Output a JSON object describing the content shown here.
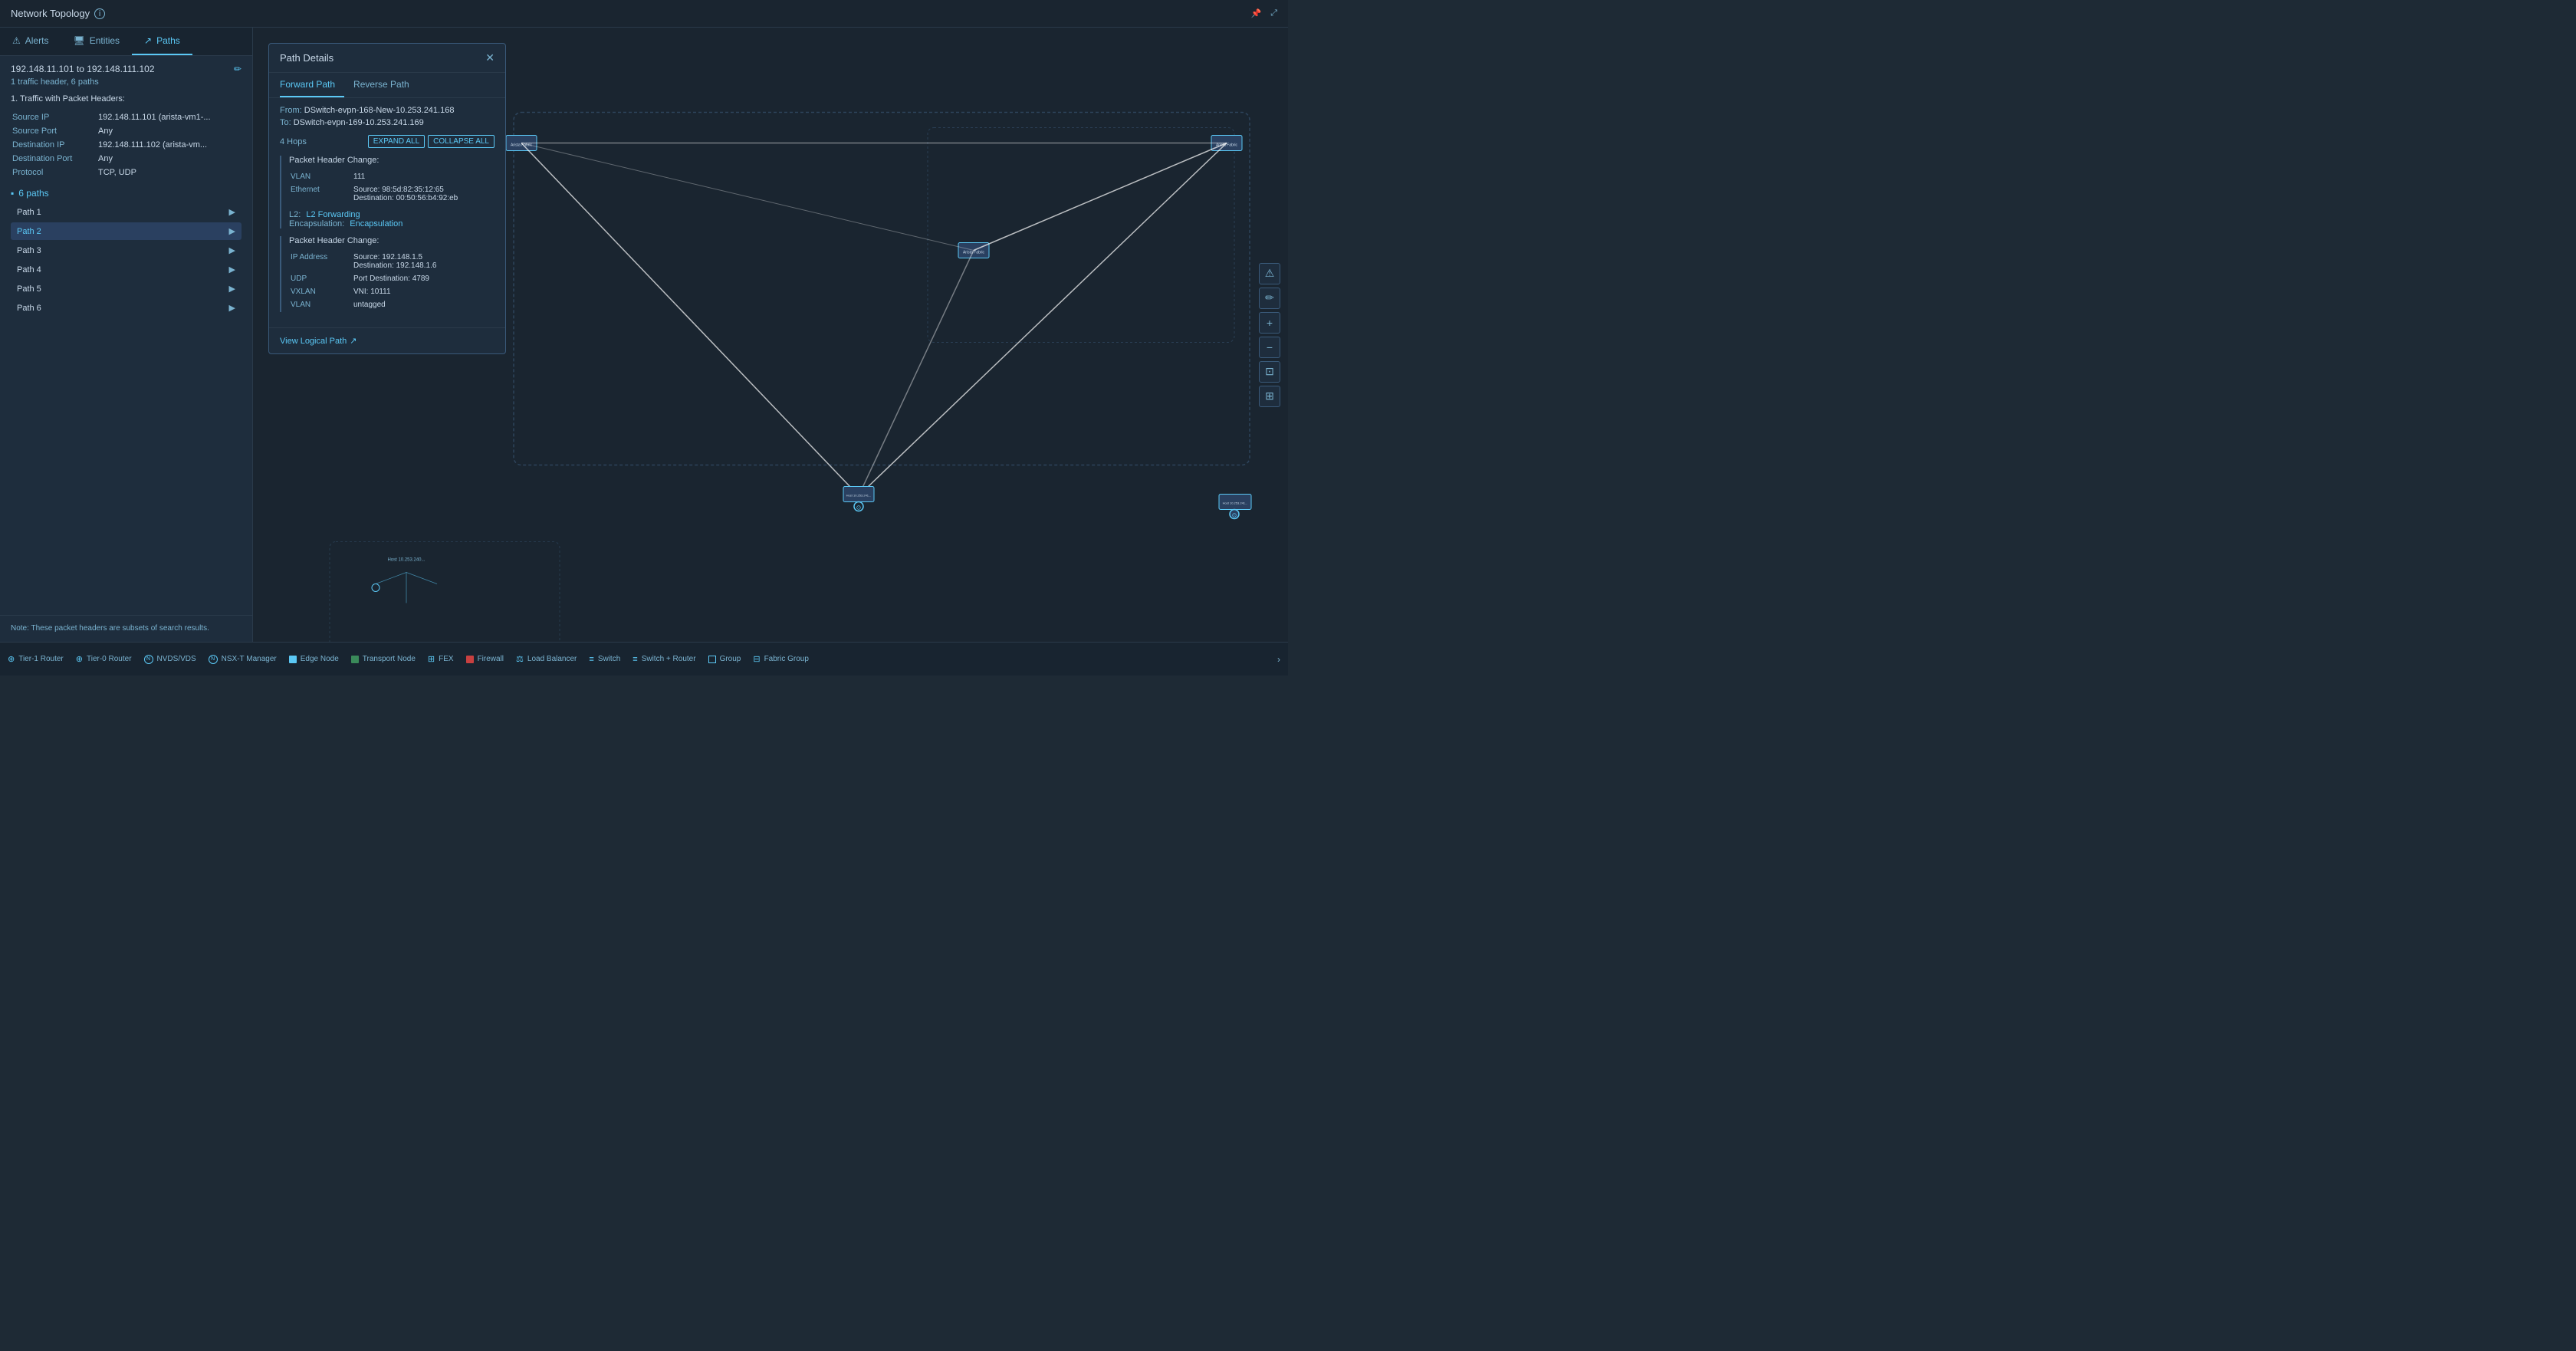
{
  "header": {
    "title": "Network Topology",
    "info_tooltip": "i",
    "pin_icon": "📌",
    "expand_icon": "⤢"
  },
  "tabs": [
    {
      "id": "alerts",
      "label": "Alerts",
      "icon": "⚠",
      "active": false
    },
    {
      "id": "entities",
      "label": "Entities",
      "icon": "🖥",
      "active": false
    },
    {
      "id": "paths",
      "label": "Paths",
      "icon": "↗",
      "active": true
    }
  ],
  "paths_panel": {
    "title": "192.148.11.101 to 192.148.111.102",
    "subtitle": "1 traffic header, 6 paths",
    "section_title": "1. Traffic with Packet Headers:",
    "fields": [
      {
        "label": "Source IP",
        "value": "192.148.11.101 (arista-vm1-..."
      },
      {
        "label": "Source Port",
        "value": "Any"
      },
      {
        "label": "Destination IP",
        "value": "192.148.111.102 (arista-vm..."
      },
      {
        "label": "Destination Port",
        "value": "Any"
      },
      {
        "label": "Protocol",
        "value": "TCP, UDP"
      }
    ],
    "paths_count": "6 paths",
    "paths": [
      {
        "id": "path1",
        "label": "Path 1",
        "active": false
      },
      {
        "id": "path2",
        "label": "Path 2",
        "active": true
      },
      {
        "id": "path3",
        "label": "Path 3",
        "active": false
      },
      {
        "id": "path4",
        "label": "Path 4",
        "active": false
      },
      {
        "id": "path5",
        "label": "Path 5",
        "active": false
      },
      {
        "id": "path6",
        "label": "Path 6",
        "active": false
      }
    ],
    "note": "Note: These packet headers are subsets of search results."
  },
  "path_details": {
    "title": "Path Details",
    "tabs": [
      {
        "label": "Forward Path",
        "active": true
      },
      {
        "label": "Reverse Path",
        "active": false
      }
    ],
    "from": "DSwitch-evpn-168-New-10.253.241.168",
    "to": "DSwitch-evpn-169-10.253.241.169",
    "hops_label": "4 Hops",
    "expand_all": "EXPAND ALL",
    "collapse_all": "COLLAPSE ALL",
    "hop1": {
      "title": "Packet Header Change:",
      "fields": [
        {
          "label": "VLAN",
          "value": "111"
        },
        {
          "label": "Ethernet",
          "value1": "Source: 98:5d:82:35:12:65",
          "value2": "Destination: 00:50:56:b4:92:eb"
        }
      ]
    },
    "hop1_l2": "L2 Forwarding",
    "hop1_encapsulation": "Encapsulation",
    "hop2": {
      "title": "Packet Header Change:",
      "fields": [
        {
          "label": "IP Address",
          "value1": "Source: 192.148.1.5",
          "value2": "Destination: 192.148.1.6"
        },
        {
          "label": "UDP",
          "value": "Port Destination: 4789"
        },
        {
          "label": "VXLAN",
          "value": "VNI: 10111"
        },
        {
          "label": "VLAN",
          "value": "untagged"
        }
      ]
    },
    "view_logical_path": "View Logical Path"
  },
  "right_tools": [
    {
      "icon": "⚠",
      "name": "alert-tool"
    },
    {
      "icon": "✏",
      "name": "edit-tool"
    },
    {
      "icon": "+",
      "name": "zoom-in-tool"
    },
    {
      "icon": "−",
      "name": "zoom-out-tool"
    },
    {
      "icon": "⊡",
      "name": "fit-tool"
    },
    {
      "icon": "⊞",
      "name": "layout-tool"
    }
  ],
  "bottom_legend": [
    {
      "icon_type": "plus-circle",
      "label": "Tier-1 Router"
    },
    {
      "icon_type": "plus-circle",
      "label": "Tier-0 Router"
    },
    {
      "icon_type": "circle-n",
      "label": "NVDS/VDS"
    },
    {
      "icon_type": "circle-n",
      "label": "NSX-T Manager"
    },
    {
      "icon_type": "square",
      "label": "Edge Node"
    },
    {
      "icon_type": "square-t",
      "label": "Transport Node"
    },
    {
      "icon_type": "grid",
      "label": "FEX"
    },
    {
      "icon_type": "rect",
      "label": "Firewall"
    },
    {
      "icon_type": "balance",
      "label": "Load Balancer"
    },
    {
      "icon_type": "lines",
      "label": "Switch"
    },
    {
      "icon_type": "lines-plus",
      "label": "Switch + Router"
    },
    {
      "icon_type": "rect-g",
      "label": "Group"
    },
    {
      "icon_type": "grid-f",
      "label": "Fabric Group"
    }
  ]
}
